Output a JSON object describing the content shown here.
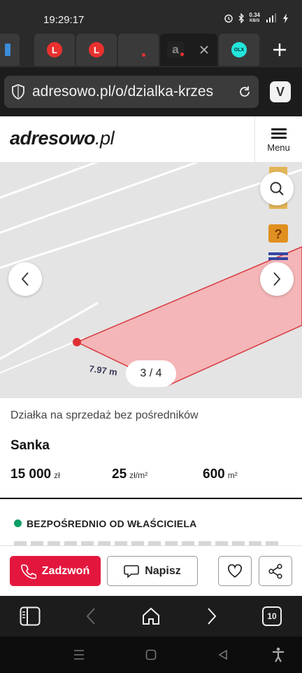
{
  "status_bar": {
    "time": "19:29:17",
    "net_speed_value": "0.34",
    "net_speed_unit": "KB/S",
    "icons": [
      "alarm-icon",
      "bluetooth-icon",
      "signal-icon",
      "charging-icon"
    ]
  },
  "tabs": {
    "items": [
      {
        "favicon": "partial-blue"
      },
      {
        "favicon": "L"
      },
      {
        "favicon": "L"
      },
      {
        "favicon": "a-dot"
      },
      {
        "favicon": "a",
        "active": true
      },
      {
        "favicon": "olx"
      }
    ],
    "olx_label": "OLX",
    "new_tab_icon": "plus-icon"
  },
  "address_bar": {
    "url": "adresowo.pl/o/dzialka-krzes",
    "vivaldi_label": "V"
  },
  "site": {
    "logo_main": "adresowo",
    "logo_suffix": ".pl",
    "menu_label": "Menu"
  },
  "gallery": {
    "counter": "3 / 4",
    "map_label": "7.97 m"
  },
  "listing": {
    "subtitle": "Działka na sprzedaż bez pośredników",
    "place": "Sanka",
    "price_value": "15 000",
    "price_unit": "zł",
    "price_per_m2_value": "25",
    "price_per_m2_unit": "zł/m²",
    "area_value": "600",
    "area_unit": "m²"
  },
  "owner": {
    "label": "BEZPOŚREDNIO OD WŁAŚCICIELA",
    "badge_color": "#0c9e63"
  },
  "actions": {
    "call_label": "Zadzwoń",
    "message_label": "Napisz",
    "accent": "#e3173e"
  },
  "browser_nav": {
    "tab_count": "10"
  }
}
